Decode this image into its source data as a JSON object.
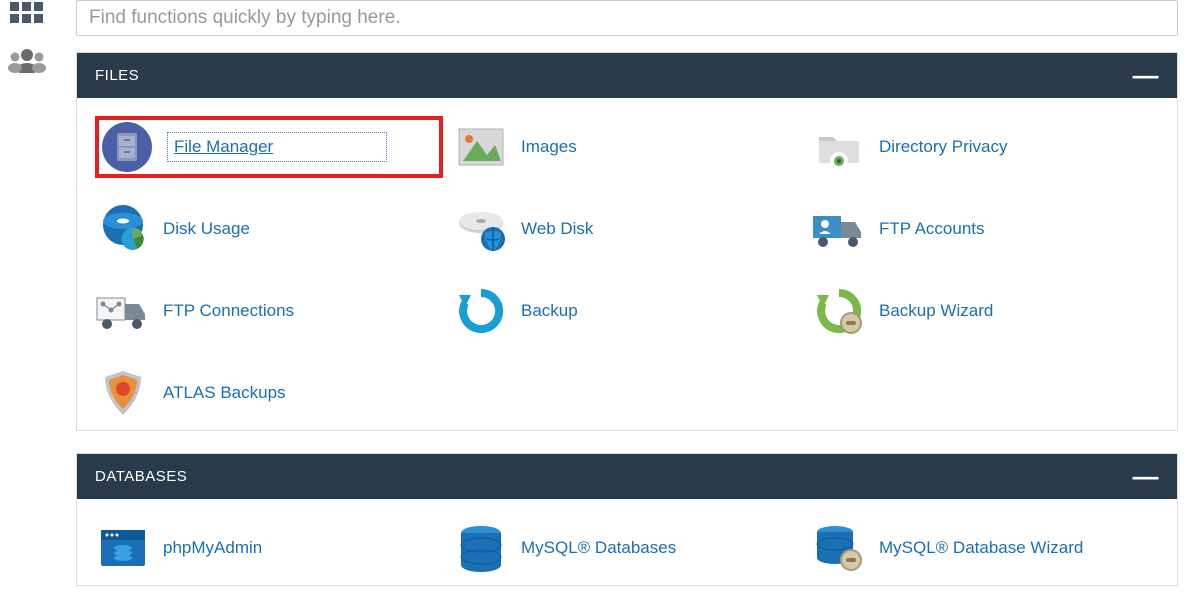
{
  "sidebar": {
    "items": [
      {
        "name": "grid-apps-icon"
      },
      {
        "name": "users-icon"
      }
    ]
  },
  "search": {
    "placeholder": "Find functions quickly by typing here."
  },
  "panels": {
    "files": {
      "title": "FILES",
      "items": [
        {
          "label": "File Manager",
          "icon": "file-cabinet",
          "highlighted": true
        },
        {
          "label": "Images",
          "icon": "image"
        },
        {
          "label": "Directory Privacy",
          "icon": "folder-eye"
        },
        {
          "label": "Disk Usage",
          "icon": "disk-pie"
        },
        {
          "label": "Web Disk",
          "icon": "disk-globe"
        },
        {
          "label": "FTP Accounts",
          "icon": "truck-user"
        },
        {
          "label": "FTP Connections",
          "icon": "truck-nodes"
        },
        {
          "label": "Backup",
          "icon": "backup-arrow"
        },
        {
          "label": "Backup Wizard",
          "icon": "backup-wizard"
        },
        {
          "label": "ATLAS Backups",
          "icon": "shield"
        }
      ]
    },
    "databases": {
      "title": "DATABASES",
      "items": [
        {
          "label": "phpMyAdmin",
          "icon": "db-window"
        },
        {
          "label": "MySQL® Databases",
          "icon": "db-stack"
        },
        {
          "label": "MySQL® Database Wizard",
          "icon": "db-wizard"
        }
      ]
    }
  }
}
